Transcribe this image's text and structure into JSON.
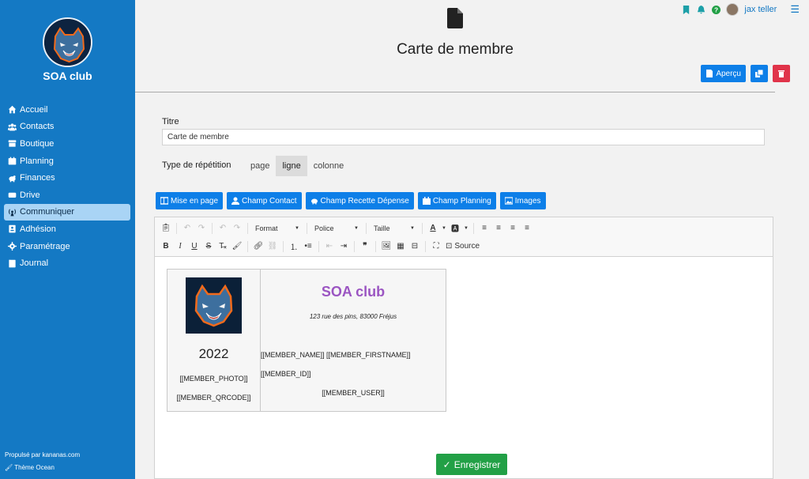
{
  "sidebar": {
    "club_name": "SOA club",
    "items": [
      {
        "label": "Accueil",
        "icon": "home-icon"
      },
      {
        "label": "Contacts",
        "icon": "users-icon"
      },
      {
        "label": "Boutique",
        "icon": "store-icon"
      },
      {
        "label": "Planning",
        "icon": "calendar-icon"
      },
      {
        "label": "Finances",
        "icon": "piggy-bank-icon"
      },
      {
        "label": "Drive",
        "icon": "drive-icon"
      },
      {
        "label": "Communiquer",
        "icon": "broadcast-icon",
        "active": true
      },
      {
        "label": "Adhésion",
        "icon": "id-card-icon"
      },
      {
        "label": "Paramétrage",
        "icon": "gear-icon"
      },
      {
        "label": "Journal",
        "icon": "book-icon"
      }
    ],
    "footer_powered": "Propulsé par kananas.com",
    "footer_theme": "Thème Ocean"
  },
  "topbar": {
    "user_name": "jax teller"
  },
  "page": {
    "title": "Carte de membre",
    "preview_label": "Aperçu"
  },
  "form": {
    "titre_label": "Titre",
    "titre_value": "Carte de membre",
    "repetition_label": "Type de répétition",
    "repetition_options": [
      "page",
      "ligne",
      "colonne"
    ],
    "repetition_selected": "ligne"
  },
  "field_buttons": [
    "Mise en page",
    "Champ Contact",
    "Champ Recette Dépense",
    "Champ Planning",
    "Images"
  ],
  "toolbar": {
    "format": "Format",
    "police": "Police",
    "taille": "Taille",
    "source": "Source"
  },
  "card": {
    "year": "2022",
    "photo_ph": "[[MEMBER_PHOTO]]",
    "qrcode_ph": "[[MEMBER_QRCODE]]",
    "club_title": "SOA club",
    "address": "123 rue des pins, 83000 Fréjus",
    "name_line": "[[MEMBER_NAME]] [[MEMBER_FIRSTNAME]]",
    "id_line": "[[MEMBER_ID]]",
    "user_line": "[[MEMBER_USER]]"
  },
  "save_label": "Enregistrer",
  "colors": {
    "sidebar": "#1479c4",
    "primary": "#0d7fe8",
    "danger": "#e0344a",
    "success": "#22a046",
    "card_title": "#9b55c2"
  }
}
